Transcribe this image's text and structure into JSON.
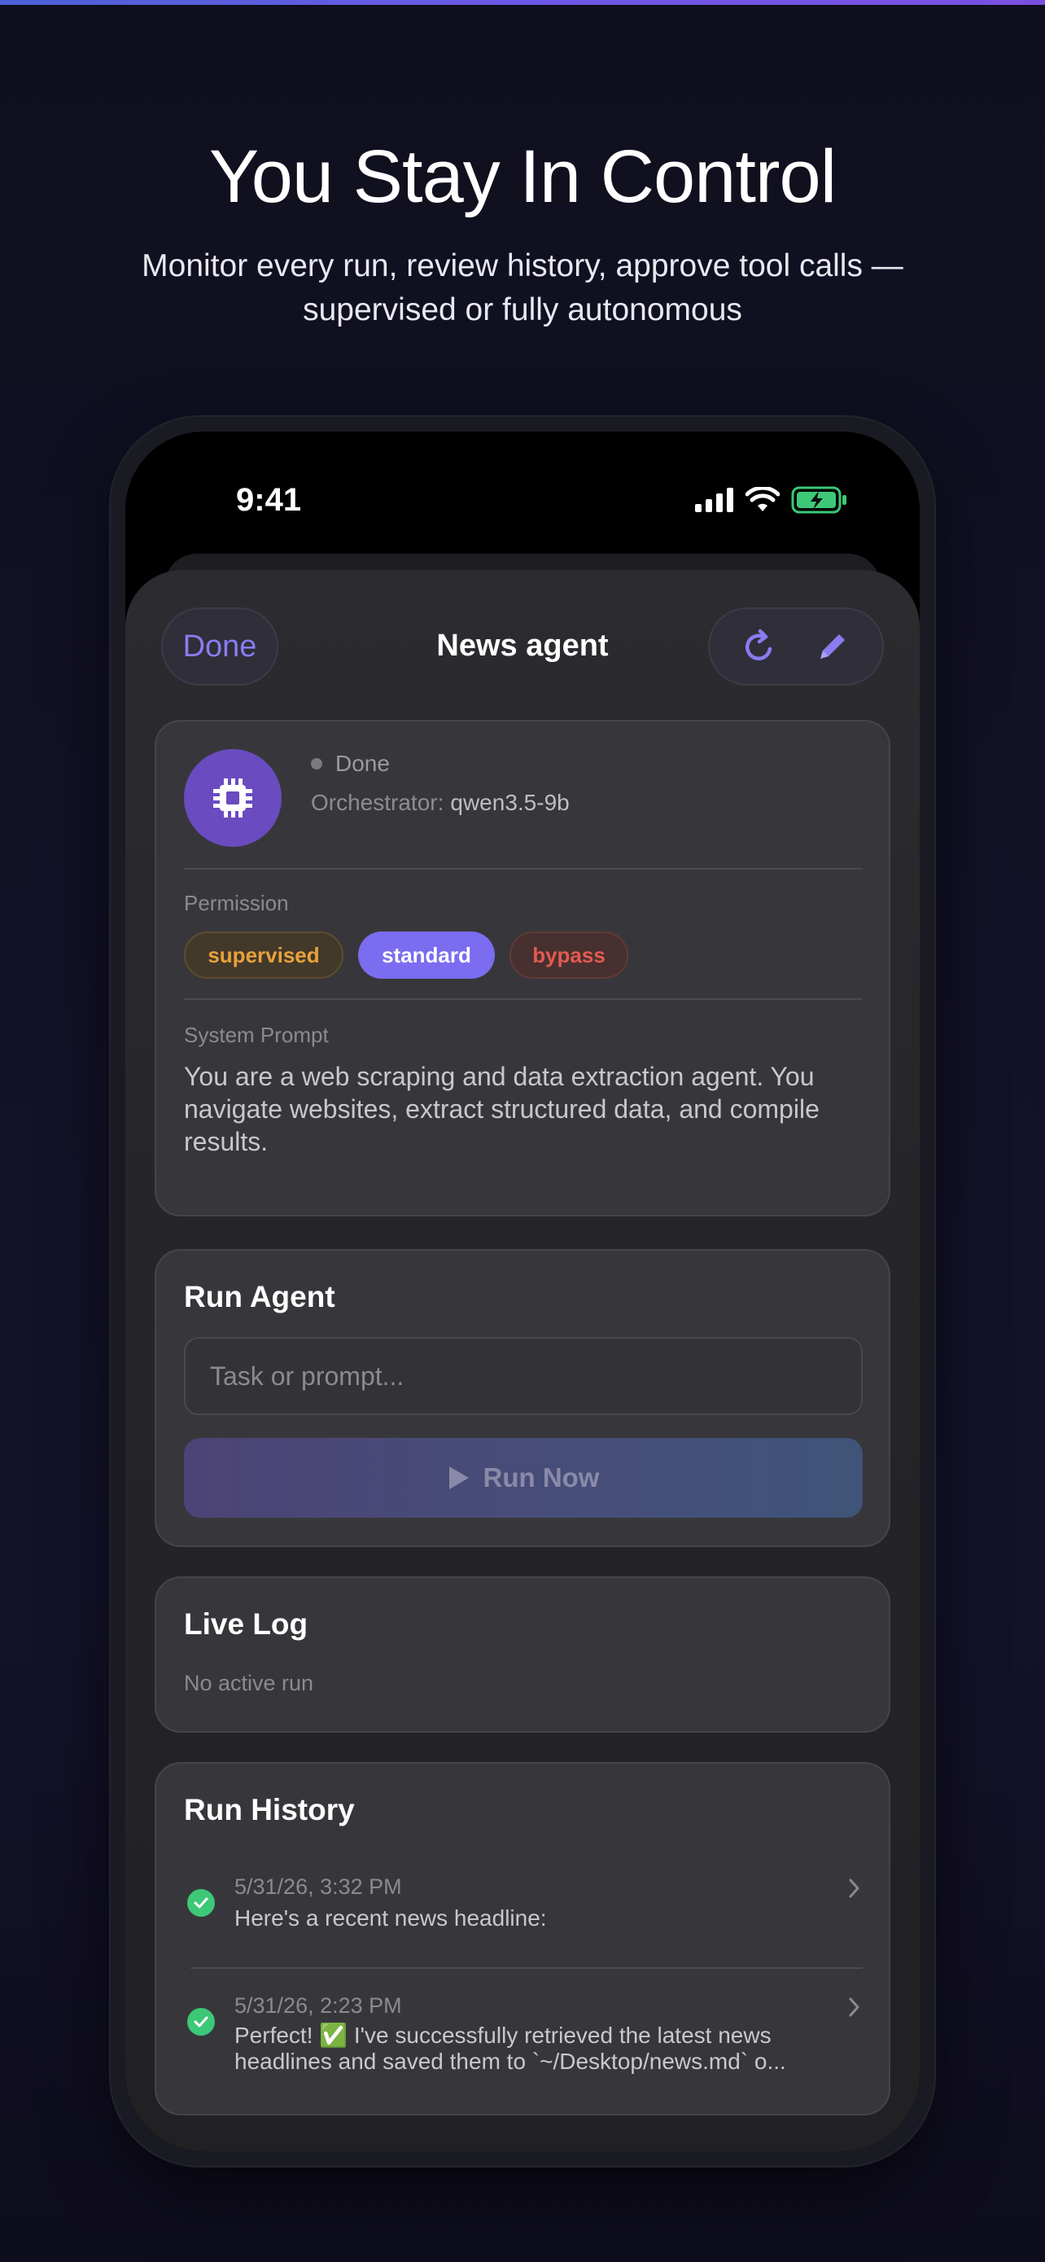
{
  "hero": {
    "title": "You Stay In Control",
    "subtitle": "Monitor every run, review history, approve tool calls — supervised or fully autonomous"
  },
  "status_bar": {
    "time": "9:41"
  },
  "header": {
    "done_label": "Done",
    "title": "News agent",
    "refresh_icon": "refresh-icon",
    "edit_icon": "pencil-icon"
  },
  "agent_card": {
    "status": "Done",
    "orchestrator_label": "Orchestrator:",
    "orchestrator_value": "qwen3.5-9b",
    "permission_label": "Permission",
    "permissions": [
      "supervised",
      "standard",
      "bypass"
    ],
    "selected_permission": "standard",
    "system_prompt_label": "System Prompt",
    "system_prompt": "You are a web scraping and data extraction agent. You navigate websites, extract structured data, and compile results."
  },
  "run_agent": {
    "title": "Run Agent",
    "input_placeholder": "Task or prompt...",
    "run_label": "Run Now"
  },
  "live_log": {
    "title": "Live Log",
    "empty_text": "No active run"
  },
  "run_history": {
    "title": "Run History",
    "items": [
      {
        "date": "5/31/26, 3:32 PM",
        "text": "Here's a recent news headline:"
      },
      {
        "date": "5/31/26, 2:23 PM",
        "text": "Perfect! ✅ I've successfully retrieved the latest news headlines and saved them to `~/Desktop/news.md` o..."
      }
    ]
  },
  "colors": {
    "accent": "#7b6cf0",
    "supervised": "#e8a23c",
    "bypass": "#e25a52",
    "success": "#3dc878"
  }
}
